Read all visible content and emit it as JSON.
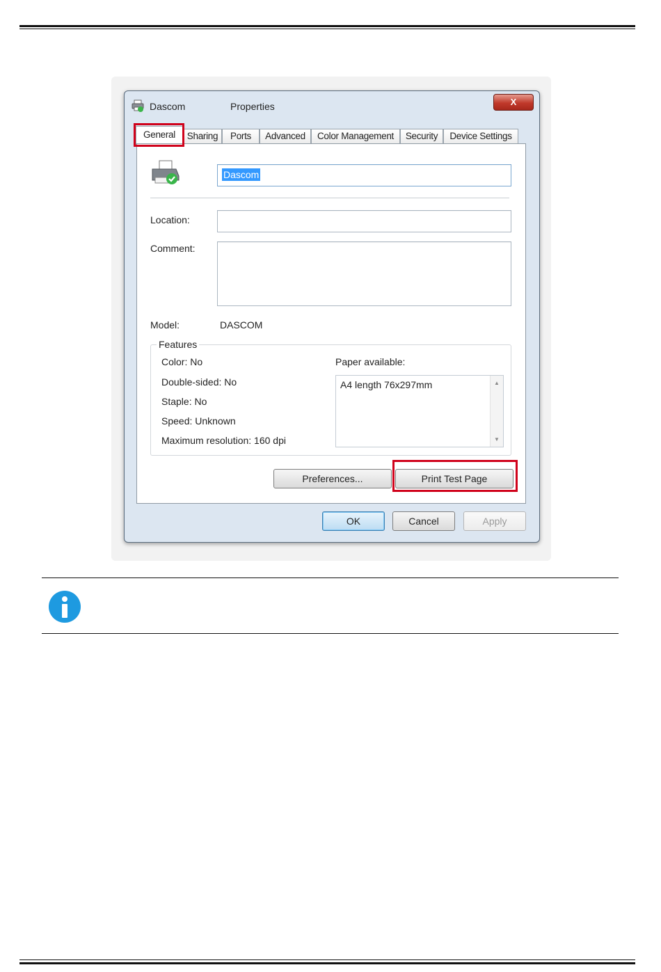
{
  "dialog": {
    "printer_name": "Dascom",
    "window_title": "Properties",
    "close_label": "X",
    "tabs": [
      "General",
      "Sharing",
      "Ports",
      "Advanced",
      "Color Management",
      "Security",
      "Device Settings"
    ],
    "active_tab": "General",
    "name_value": "Dascom",
    "location_label": "Location:",
    "location_value": "",
    "comment_label": "Comment:",
    "comment_value": "",
    "model_label": "Model:",
    "model_value": "DASCOM",
    "features": {
      "legend": "Features",
      "color": "Color: No",
      "double_sided": "Double-sided: No",
      "staple": "Staple: No",
      "speed": "Speed: Unknown",
      "max_resolution": "Maximum resolution: 160 dpi",
      "paper_label": "Paper available:",
      "paper_items": [
        "A4 length 76x297mm"
      ]
    },
    "buttons": {
      "preferences": "Preferences...",
      "print_test_page": "Print Test Page",
      "ok": "OK",
      "cancel": "Cancel",
      "apply": "Apply"
    }
  },
  "colors": {
    "highlight": "#d0021b",
    "info_icon": "#1e9ae0",
    "selection": "#3399ff"
  },
  "icons": [
    "printer-icon",
    "close-icon",
    "info-icon",
    "scroll-up-icon",
    "scroll-down-icon"
  ]
}
